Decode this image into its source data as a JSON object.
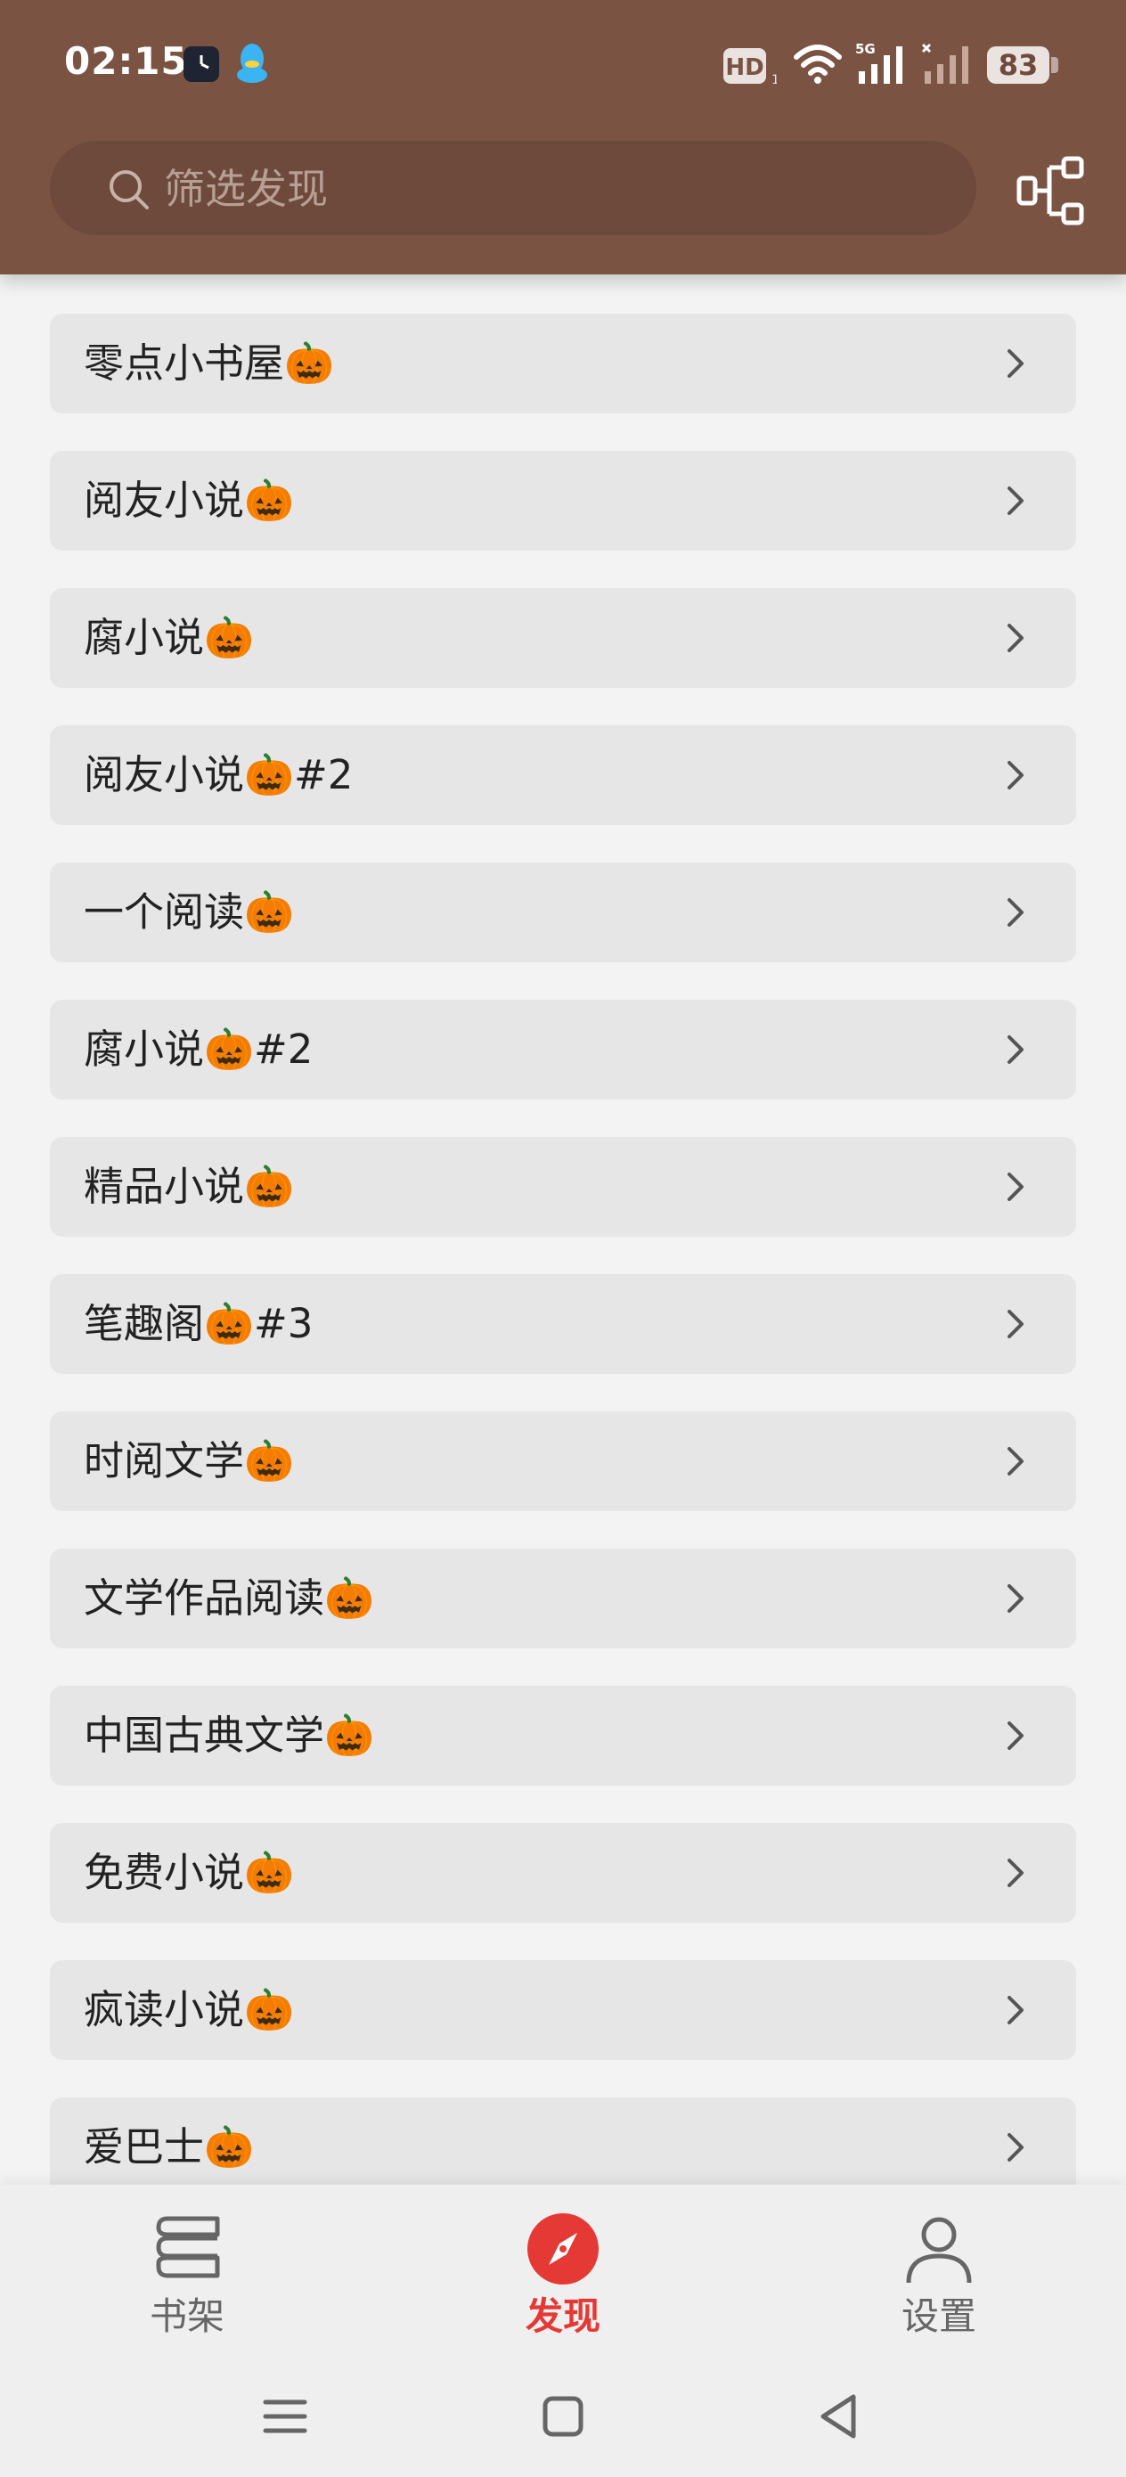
{
  "status_bar": {
    "time": "02:15",
    "hd_label": "HD",
    "hd_sub": "1",
    "network_label": "5G",
    "battery": "83",
    "icons": [
      "clock-app-icon",
      "qq-penguin-icon",
      "hd-voice-icon",
      "wifi-icon",
      "signal-5g-icon",
      "signal-no-sim-icon",
      "battery-icon"
    ]
  },
  "search": {
    "placeholder": "筛选发现",
    "value": ""
  },
  "colors": {
    "header": "#7a5343",
    "accent": "#e53935"
  },
  "sources": [
    {
      "label": "零点小书屋🎃"
    },
    {
      "label": "阅友小说🎃"
    },
    {
      "label": "腐小说🎃"
    },
    {
      "label": "阅友小说🎃#2"
    },
    {
      "label": "一个阅读🎃"
    },
    {
      "label": "腐小说🎃#2"
    },
    {
      "label": "精品小说🎃"
    },
    {
      "label": "笔趣阁🎃#3"
    },
    {
      "label": "时阅文学🎃"
    },
    {
      "label": "文学作品阅读🎃"
    },
    {
      "label": "中国古典文学🎃"
    },
    {
      "label": "免费小说🎃"
    },
    {
      "label": "疯读小说🎃"
    },
    {
      "label": "爱巴士🎃"
    }
  ],
  "bottom_nav": {
    "bookshelf": "书架",
    "discover": "发现",
    "settings": "设置",
    "active": "discover"
  }
}
